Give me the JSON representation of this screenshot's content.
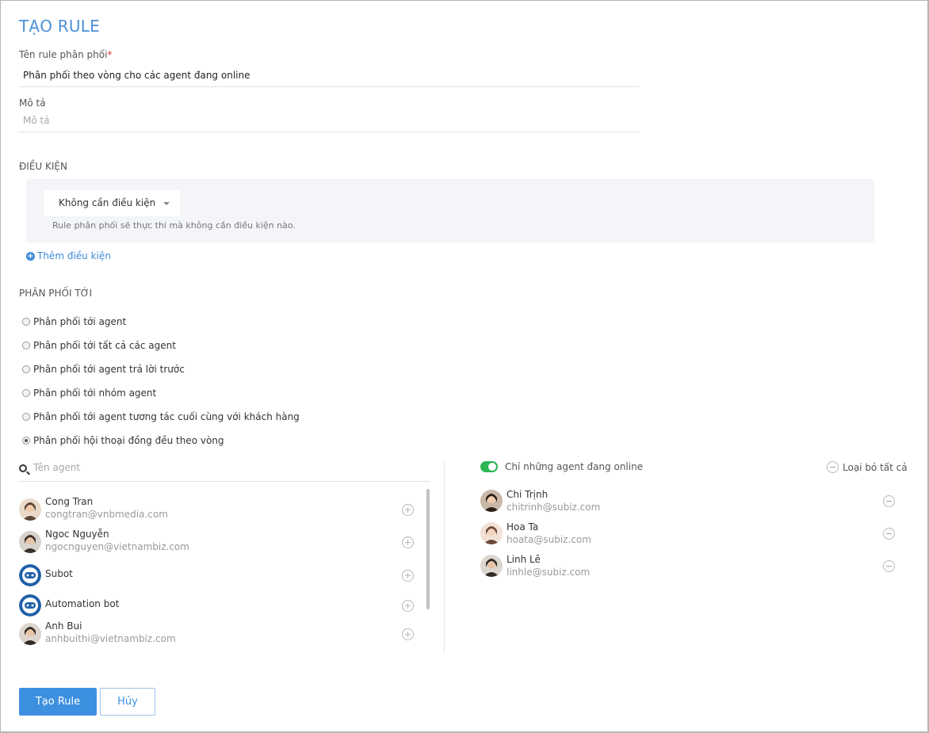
{
  "page": {
    "title": "TẠO RULE",
    "colors": {
      "accent": "#3d8fe0",
      "toggle_on": "#2db553",
      "required": "#e03c3c"
    }
  },
  "form": {
    "name_label": "Tên rule phân phối",
    "required_mark": "*",
    "name_value": "Phân phối theo vòng cho các agent đang online",
    "desc_label": "Mô tả",
    "desc_placeholder": "Mô tả"
  },
  "conditions": {
    "section_label": "ĐIỀU KIỆN",
    "select_value": "Không cần điều kiện",
    "hint": "Rule phân phối sẽ thực thi mà không cần điều kiện nào.",
    "add_label": "Thêm điều kiện"
  },
  "distribution": {
    "section_label": "PHÂN PHỐI TỚI",
    "options": [
      {
        "label": "Phân phối tới agent",
        "checked": false
      },
      {
        "label": "Phân phối tới tất cả các agent",
        "checked": false
      },
      {
        "label": "Phân phối tới agent trả lời trước",
        "checked": false
      },
      {
        "label": "Phân phối tới nhóm agent",
        "checked": false
      },
      {
        "label": "Phân phối tới agent tương tác cuối cùng với khách hàng",
        "checked": false
      },
      {
        "label": "Phân phối hội thoại đồng đều theo vòng",
        "checked": true
      }
    ]
  },
  "agent_search": {
    "placeholder": "Tên agent",
    "icon": "search-icon"
  },
  "available_agents": [
    {
      "name": "Cong Tran",
      "email": "congtran@vnbmedia.com",
      "avatar": "person"
    },
    {
      "name": "Ngoc Nguyễn",
      "email": "ngocnguyen@vietnambiz.com",
      "avatar": "person"
    },
    {
      "name": "Subot",
      "email": "",
      "avatar": "bot"
    },
    {
      "name": "Automation bot",
      "email": "",
      "avatar": "bot"
    },
    {
      "name": "Anh Bui",
      "email": "anhbuithi@vietnambiz.com",
      "avatar": "person"
    }
  ],
  "selected_panel": {
    "toggle_label": "Chỉ những agent đang online",
    "toggle_on": true,
    "remove_all_label": "Loại bỏ tất cả"
  },
  "selected_agents": [
    {
      "name": "Chi Trịnh",
      "email": "chitrinh@subiz.com"
    },
    {
      "name": "Hoa Ta",
      "email": "hoata@subiz.com"
    },
    {
      "name": "Linh Lê",
      "email": "linhle@subiz.com"
    }
  ],
  "actions": {
    "submit_label": "Tạo Rule",
    "cancel_label": "Hủy"
  }
}
